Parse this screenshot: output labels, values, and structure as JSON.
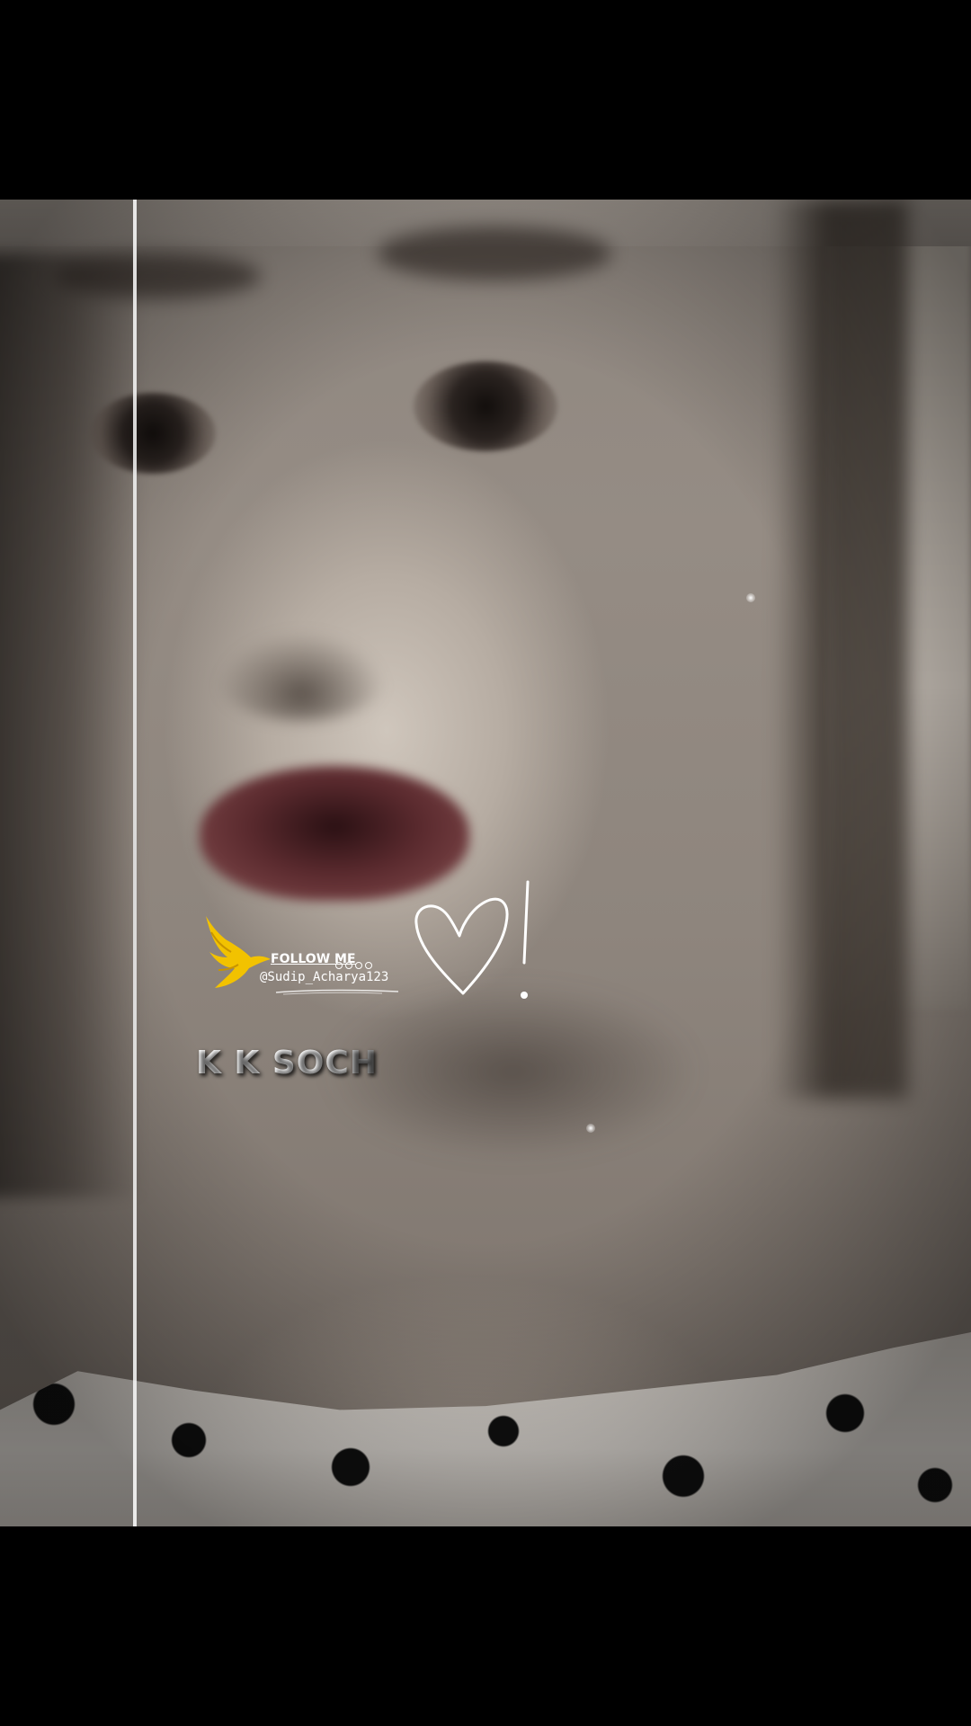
{
  "watermark": {
    "follow_label": "FOLLOW ME",
    "handle": "@Sudip_Acharya123",
    "social_icon_count": 4,
    "accent_color": "#f2c200",
    "bird_icon": "bird-logo-icon"
  },
  "caption": {
    "text": "K K SOCH"
  },
  "decorations": {
    "heart_icon": "hand-drawn-heart-icon",
    "line_color": "#ffffff"
  }
}
